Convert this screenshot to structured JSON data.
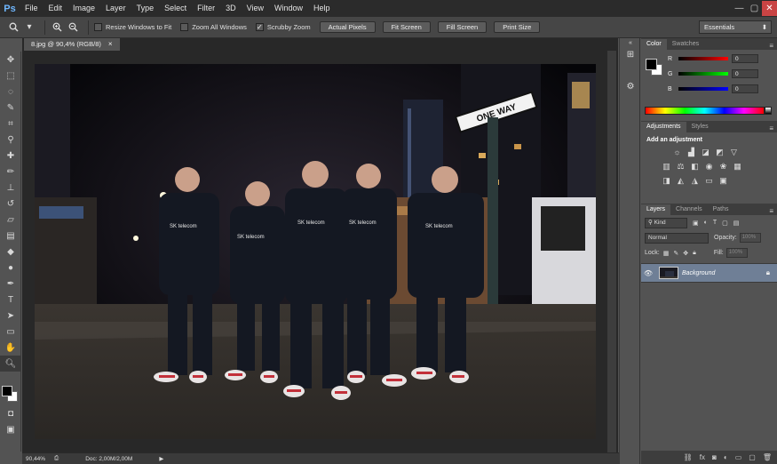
{
  "app": {
    "logo": "Ps",
    "menu": [
      "File",
      "Edit",
      "Image",
      "Layer",
      "Type",
      "Select",
      "Filter",
      "3D",
      "View",
      "Window",
      "Help"
    ],
    "window_buttons": [
      "—",
      "▢",
      "✕"
    ]
  },
  "options_bar": {
    "tool_icon": "zoom-icon",
    "resize_windows": {
      "label": "Resize Windows to Fit",
      "checked": false
    },
    "zoom_all_windows": {
      "label": "Zoom All Windows",
      "checked": false
    },
    "scrubby_zoom": {
      "label": "Scrubby Zoom",
      "checked": true
    },
    "buttons": [
      "Actual Pixels",
      "Fit Screen",
      "Fill Screen",
      "Print Size"
    ],
    "workspace": "Essentials"
  },
  "document": {
    "tab_title": "8.jpg @ 90,4% (RGB/8)",
    "close_glyph": "×"
  },
  "status_bar": {
    "zoom": "90,44%",
    "doc_info": "Doc: 2,00M/2,00M"
  },
  "color_panel": {
    "tabs": [
      "Color",
      "Swatches"
    ],
    "channels": [
      {
        "label": "R",
        "value": "0",
        "color": "#d33"
      },
      {
        "label": "G",
        "value": "0",
        "color": "#3b3"
      },
      {
        "label": "B",
        "value": "0",
        "color": "#33d"
      }
    ]
  },
  "adjustments_panel": {
    "tabs": [
      "Adjustments",
      "Styles"
    ],
    "title": "Add an adjustment"
  },
  "layers_panel": {
    "tabs": [
      "Layers",
      "Channels",
      "Paths"
    ],
    "kind": "Kind",
    "blend_mode": "Normal",
    "opacity_label": "Opacity:",
    "opacity_value": "100%",
    "lock_label": "Lock:",
    "fill_label": "Fill:",
    "fill_value": "100%",
    "layers": [
      {
        "name": "Background",
        "visible": true,
        "locked": true
      }
    ]
  }
}
